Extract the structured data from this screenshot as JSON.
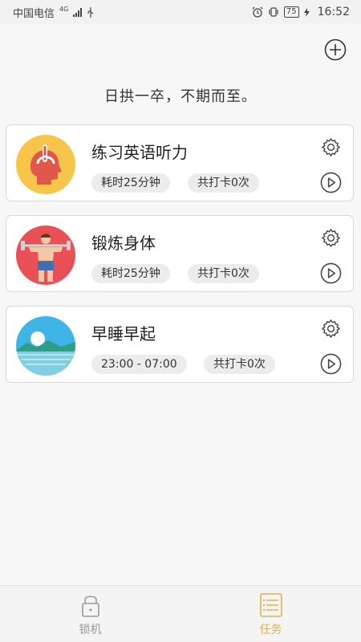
{
  "status": {
    "carrier": "中国电信",
    "network": "4G",
    "battery": "75",
    "time": "16:52"
  },
  "header": {
    "motto": "日拱一卒，不期而至。"
  },
  "tasks": [
    {
      "title": "练习英语听力",
      "chip1": "耗时25分钟",
      "chip2": "共打卡0次",
      "icon": "headphones-head-icon"
    },
    {
      "title": "锻炼身体",
      "chip1": "耗时25分钟",
      "chip2": "共打卡0次",
      "icon": "dumbbell-man-icon"
    },
    {
      "title": "早睡早起",
      "chip1": "23:00 - 07:00",
      "chip2": "共打卡0次",
      "icon": "sunrise-landscape-icon"
    }
  ],
  "nav": {
    "lock_label": "锁机",
    "tasks_label": "任务"
  },
  "colors": {
    "accent": "#e0b24a",
    "icon_gray": "#555555",
    "nav_inactive": "#9a9a9a"
  }
}
